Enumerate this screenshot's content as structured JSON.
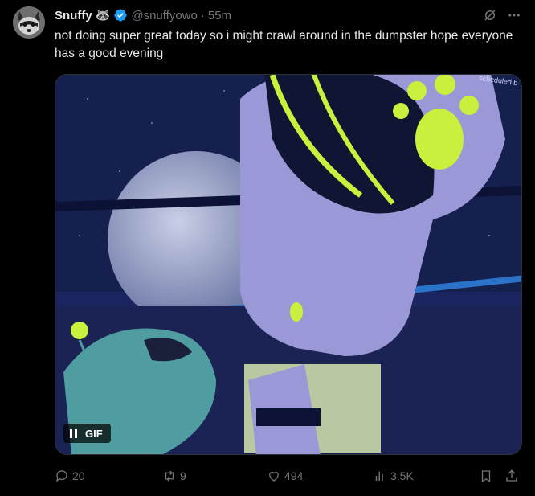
{
  "tweet": {
    "author_name": "Snuffy",
    "author_emoji": "🦝",
    "handle": "@snuffyowo",
    "separator": "·",
    "time": "55m",
    "text": "not doing super great today so i might crawl around in the dumpster hope everyone has a good evening"
  },
  "media": {
    "gif_label": "GIF",
    "watermark": "scheduled b"
  },
  "actions": {
    "replies": "20",
    "reposts": "9",
    "likes": "494",
    "views": "3.5K"
  },
  "icons": {
    "verified": "verified-badge-icon",
    "grok": "grok-icon",
    "more": "more-icon",
    "reply": "reply-icon",
    "repost": "repost-icon",
    "like": "heart-icon",
    "views": "views-icon",
    "bookmark": "bookmark-icon",
    "share": "share-icon"
  },
  "colors": {
    "background": "#000000",
    "text": "#e7e9ea",
    "muted": "#71767b",
    "verified": "#1d9bf0",
    "neon": "#c8f03c",
    "fur": "#9a98d6"
  }
}
